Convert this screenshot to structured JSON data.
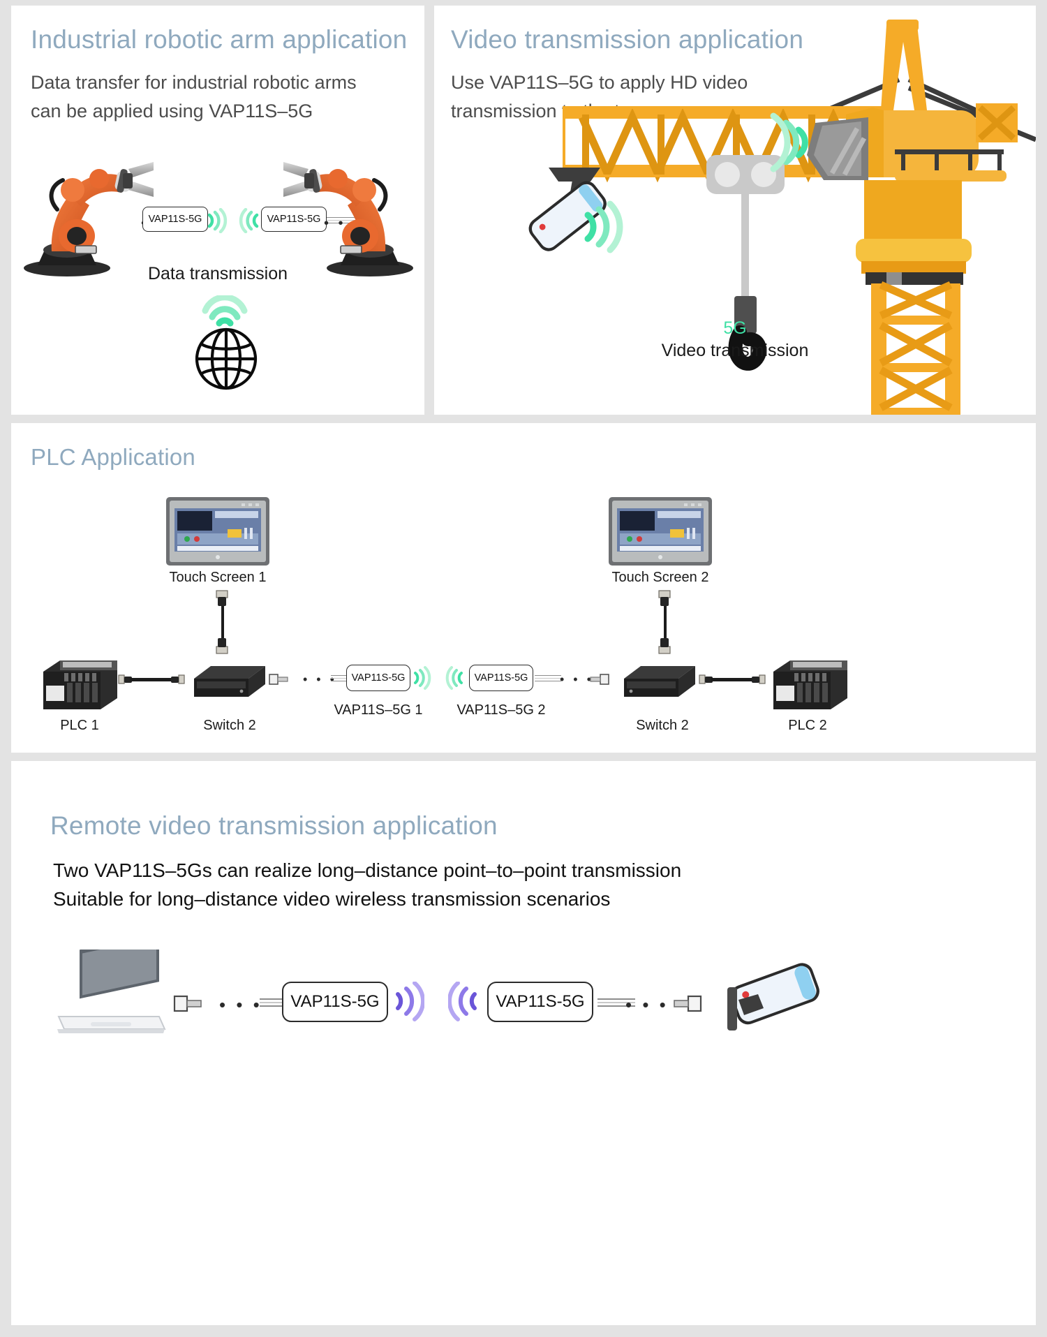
{
  "theme": {
    "page_bg": "#e3e3e3",
    "card_bg": "#ffffff",
    "title_color": "#8fa9be",
    "body_color": "#4c4c4c",
    "accent_green": "#5fe3ae",
    "accent_green_light": "#a6f0c9",
    "accent_purple": "#8d79e8",
    "crane_yellow": "#f4b52a",
    "robot_orange": "#e8622a"
  },
  "panels": {
    "robot": {
      "title": "Industrial robotic arm application",
      "subtitle_line1": "Data transfer for industrial robotic arms",
      "subtitle_line2": "can be applied using VAP11S–5G",
      "device_left_label": "VAP11S-5G",
      "device_right_label": "VAP11S-5G",
      "caption": "Data transmission",
      "icons": {
        "wifi": "wifi-icon",
        "globe": "globe-icon"
      }
    },
    "video": {
      "title": "Video transmission application",
      "subtitle_line1": "Use VAP11S–5G to apply HD video",
      "subtitle_line2": "transmission to the tower",
      "badge": "5G",
      "caption": "Video transmission"
    },
    "plc": {
      "title": "PLC Application",
      "labels": {
        "touch_screen_1": "Touch Screen 1",
        "touch_screen_2": "Touch Screen 2",
        "plc_1": "PLC 1",
        "plc_2": "PLC 2",
        "switch_left": "Switch 2",
        "switch_right": "Switch 2",
        "vap_1": "VAP11S–5G 1",
        "vap_2": "VAP11S–5G 2"
      },
      "device_left_label": "VAP11S-5G",
      "device_right_label": "VAP11S-5G"
    },
    "remote": {
      "title": "Remote video transmission application",
      "subtitle_line1": "Two VAP11S–5Gs can realize long–distance point–to–point transmission",
      "subtitle_line2": "Suitable for long–distance video wireless transmission scenarios",
      "device_left_label": "VAP11S-5G",
      "device_right_label": "VAP11S-5G"
    }
  },
  "dots": "• • •"
}
